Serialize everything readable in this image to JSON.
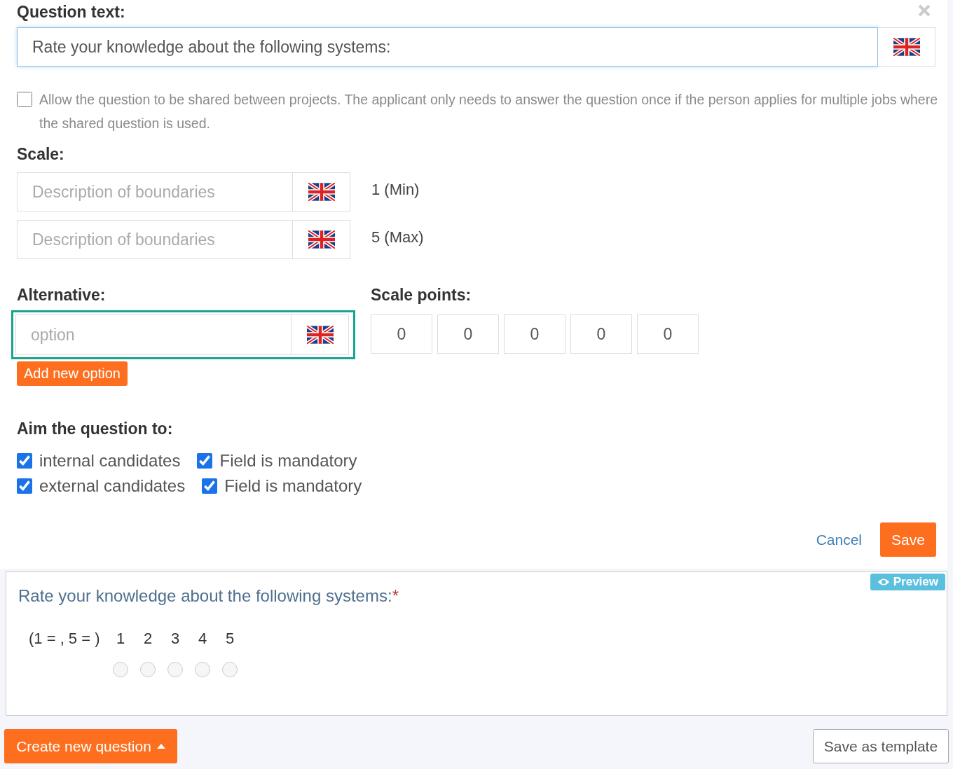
{
  "question_text": {
    "label": "Question text:",
    "value": "Rate your knowledge about the following systems:"
  },
  "share_option": {
    "checked": false,
    "text": "Allow the question to be shared between projects. The applicant only needs to answer the question once if the person applies for multiple jobs where the shared question is used."
  },
  "scale": {
    "label": "Scale:",
    "boundaries": [
      {
        "placeholder": "Description of boundaries",
        "end_label": "1 (Min)"
      },
      {
        "placeholder": "Description of boundaries",
        "end_label": "5 (Max)"
      }
    ]
  },
  "alternative": {
    "label": "Alternative:",
    "placeholder": "option",
    "highlighted": true
  },
  "scale_points": {
    "label": "Scale points:",
    "values": [
      "0",
      "0",
      "0",
      "0",
      "0"
    ]
  },
  "add_option_button": "Add new option",
  "aim": {
    "label": "Aim the question to:",
    "rows": [
      {
        "audience": {
          "label": "internal candidates",
          "checked": true
        },
        "mandatory": {
          "label": "Field is mandatory",
          "checked": true
        }
      },
      {
        "audience": {
          "label": "external candidates",
          "checked": true
        },
        "mandatory": {
          "label": "Field is mandatory",
          "checked": true
        }
      }
    ]
  },
  "actions": {
    "cancel": "Cancel",
    "save": "Save"
  },
  "preview": {
    "badge": "Preview",
    "question": "Rate your knowledge about the following systems:",
    "required_mark": "*",
    "scale_label": "(1 = , 5 = )",
    "points": [
      {
        "label": "1",
        "selected": false
      },
      {
        "label": "2",
        "selected": false
      },
      {
        "label": "3",
        "selected": false
      },
      {
        "label": "4",
        "selected": false
      },
      {
        "label": "5",
        "selected": false
      }
    ]
  },
  "footer": {
    "create_button": "Create new question",
    "template_button": "Save as template"
  }
}
